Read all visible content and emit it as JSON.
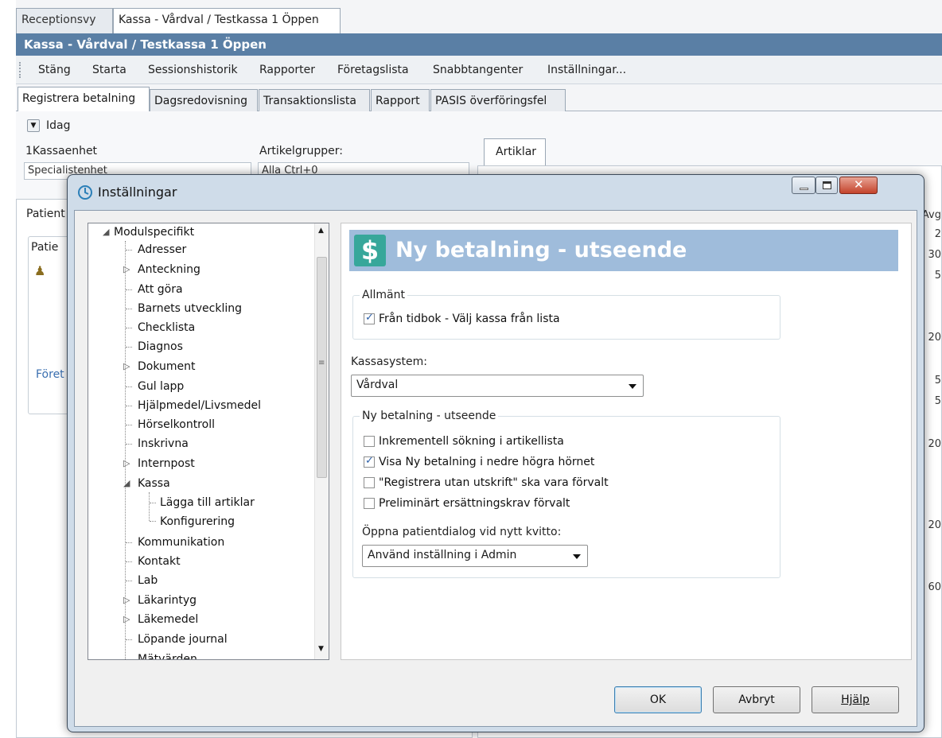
{
  "top_tabs": [
    "Receptionsvy",
    "Kassa - Vårdval / Testkassa 1 Öppen"
  ],
  "app_title": "Kassa - Vårdval / Testkassa 1 Öppen",
  "menu": [
    "Stäng",
    "Starta",
    "Sessionshistorik",
    "Rapporter",
    "Företagslista",
    "Snabbtangenter",
    "Inställningar..."
  ],
  "sub_tabs": [
    "Registrera betalning",
    "Dagsredovisning",
    "Transaktionslista",
    "Rapport",
    "PASIS överföringsfel"
  ],
  "background": {
    "idag_label": "Idag",
    "kassaenhet_label": "1Kassaenhet",
    "kassaenhet_value": "Specialistenhet",
    "artikelgrupper_label": "Artikelgrupper:",
    "artikelgrupper_value": "Alla Ctrl+0",
    "artiklar_tab": "Artiklar",
    "patient_tab": "Patient",
    "patient_group": "Patie",
    "foretag_link": "Föret",
    "right_col_header": "Avg",
    "edge_numbers": [
      "2",
      "30",
      "5",
      "20",
      "5",
      "5",
      "20",
      "20",
      "60"
    ]
  },
  "dialog": {
    "title": "Inställningar",
    "tree": [
      {
        "label": "Modulspecifikt",
        "level": 0,
        "expander": "open"
      },
      {
        "label": "Adresser",
        "level": 1,
        "expander": "none"
      },
      {
        "label": "Anteckning",
        "level": 1,
        "expander": "closed"
      },
      {
        "label": "Att göra",
        "level": 1,
        "expander": "none"
      },
      {
        "label": "Barnets utveckling",
        "level": 1,
        "expander": "none"
      },
      {
        "label": "Checklista",
        "level": 1,
        "expander": "none"
      },
      {
        "label": "Diagnos",
        "level": 1,
        "expander": "none"
      },
      {
        "label": "Dokument",
        "level": 1,
        "expander": "closed"
      },
      {
        "label": "Gul lapp",
        "level": 1,
        "expander": "none"
      },
      {
        "label": "Hjälpmedel/Livsmedel",
        "level": 1,
        "expander": "none"
      },
      {
        "label": "Hörselkontroll",
        "level": 1,
        "expander": "none"
      },
      {
        "label": "Inskrivna",
        "level": 1,
        "expander": "none"
      },
      {
        "label": "Internpost",
        "level": 1,
        "expander": "closed"
      },
      {
        "label": "Kassa",
        "level": 1,
        "expander": "open"
      },
      {
        "label": "Lägga till artiklar",
        "level": 2,
        "expander": "none"
      },
      {
        "label": "Konfigurering",
        "level": 2,
        "expander": "none"
      },
      {
        "label": "Kommunikation",
        "level": 1,
        "expander": "none"
      },
      {
        "label": "Kontakt",
        "level": 1,
        "expander": "none"
      },
      {
        "label": "Lab",
        "level": 1,
        "expander": "none"
      },
      {
        "label": "Läkarintyg",
        "level": 1,
        "expander": "closed"
      },
      {
        "label": "Läkemedel",
        "level": 1,
        "expander": "closed"
      },
      {
        "label": "Löpande journal",
        "level": 1,
        "expander": "none"
      },
      {
        "label": "Mätvärden",
        "level": 1,
        "expander": "none"
      }
    ],
    "panel": {
      "title": "Ny betalning - utseende",
      "icon": "dollar-icon",
      "group_allmant": {
        "legend": "Allmänt",
        "checkbox": {
          "label": "Från tidbok - Välj kassa från lista",
          "checked": true
        }
      },
      "kassasystem_label": "Kassasystem:",
      "kassasystem_value": "Vårdval",
      "group_ny": {
        "legend": "Ny betalning - utseende",
        "checkboxes": [
          {
            "label": "Inkrementell sökning i artikellista",
            "checked": false
          },
          {
            "label": "Visa Ny betalning i nedre högra hörnet",
            "checked": true
          },
          {
            "label": "\"Registrera utan utskrift\" ska vara förvalt",
            "checked": false
          },
          {
            "label": "Preliminärt ersättningskrav förvalt",
            "checked": false
          }
        ],
        "patientdialog_label": "Öppna patientdialog vid nytt kvitto:",
        "patientdialog_value": "Använd inställning i Admin"
      }
    },
    "buttons": {
      "ok": "OK",
      "cancel": "Avbryt",
      "help": "Hjälp"
    },
    "colors": {
      "header_band": "#9fbcdb",
      "dollar_bg": "#37a79a",
      "app_title_bg": "#5a7fa5"
    }
  }
}
